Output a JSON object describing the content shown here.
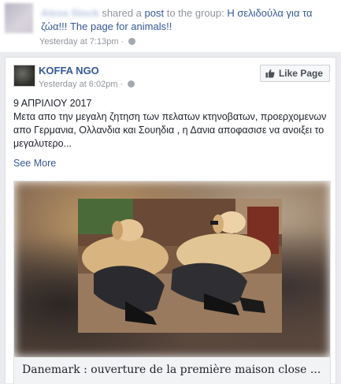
{
  "share": {
    "actor_name": "Alexa Stock",
    "action_text": " shared a ",
    "post_link": "post",
    "to_group_text": " to the group: ",
    "group_name": "Η σελιδούλα για τα ζώα!!! The page for animals!!",
    "timestamp": "Yesterday at 7:13pm",
    "separator": " · "
  },
  "post": {
    "page_name": "KOFFA NGO",
    "timestamp": "Yesterday at 6:02pm",
    "separator": " · ",
    "like_page_label": "Like Page",
    "date_line": "9 ΑΠΡΙΛΙΟΥ 2017",
    "body": "Μετα απο την μεγαλη ζητηση των πελατων κτηνοβατων, προερχομενων απο Γερμανια, Ολλανδια και Σουηδια , η Δανια αποφασισε να ανοιξει το μεγαλυτερο...",
    "see_more": "See More"
  },
  "preview": {
    "title": "Danemark : ouverture de la première maison close ..."
  },
  "colors": {
    "link": "#365899",
    "meta": "#90949c",
    "background": "#e9ebee"
  }
}
